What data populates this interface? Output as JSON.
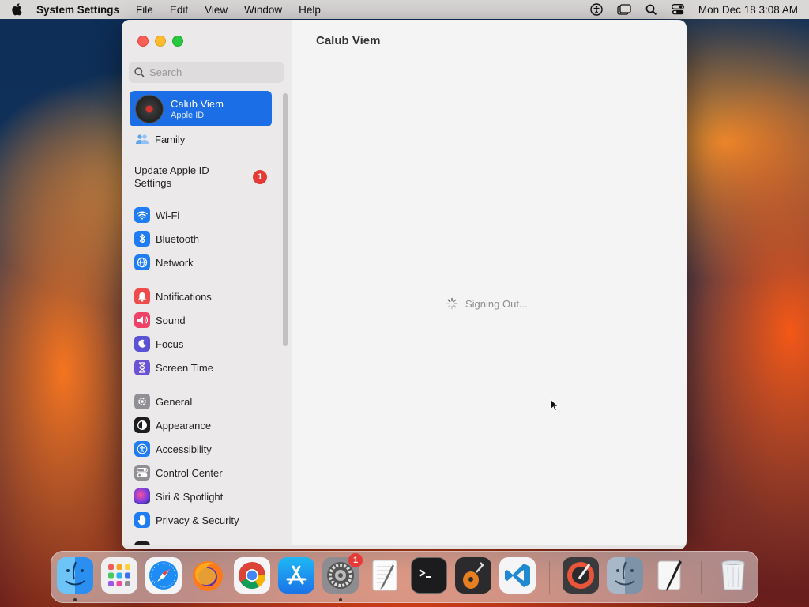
{
  "menubar": {
    "app_name": "System Settings",
    "items": [
      "File",
      "Edit",
      "View",
      "Window",
      "Help"
    ],
    "clock": "Mon Dec 18  3:08 AM"
  },
  "window": {
    "title": "Calub Viem",
    "status": "Signing Out..."
  },
  "sidebar": {
    "search_placeholder": "Search",
    "profile": {
      "name": "Calub Viem",
      "subtitle": "Apple ID"
    },
    "family": "Family",
    "update": {
      "label": "Update Apple ID Settings",
      "badge": "1"
    },
    "groups": [
      [
        {
          "label": "Wi-Fi",
          "icon": "wifi-icon",
          "color": "#1f7cf3"
        },
        {
          "label": "Bluetooth",
          "icon": "bluetooth-icon",
          "color": "#1f7cf3"
        },
        {
          "label": "Network",
          "icon": "network-globe-icon",
          "color": "#1f7cf3"
        }
      ],
      [
        {
          "label": "Notifications",
          "icon": "bell-icon",
          "color": "#ef4b4b"
        },
        {
          "label": "Sound",
          "icon": "speaker-icon",
          "color": "#ef4266"
        },
        {
          "label": "Focus",
          "icon": "moon-icon",
          "color": "#5a53d6"
        },
        {
          "label": "Screen Time",
          "icon": "hourglass-icon",
          "color": "#6b52d6"
        }
      ],
      [
        {
          "label": "General",
          "icon": "gear-icon",
          "color": "#8f8f94"
        },
        {
          "label": "Appearance",
          "icon": "appearance-icon",
          "color": "#1d1d1f"
        },
        {
          "label": "Accessibility",
          "icon": "accessibility-icon",
          "color": "#1f7cf3"
        },
        {
          "label": "Control Center",
          "icon": "control-center-icon",
          "color": "#8f8f94"
        },
        {
          "label": "Siri & Spotlight",
          "icon": "siri-icon",
          "color": "#b23cc8"
        },
        {
          "label": "Privacy & Security",
          "icon": "hand-icon",
          "color": "#1f7cf3"
        }
      ]
    ]
  },
  "dock": {
    "settings_badge": "1",
    "apps": [
      "Finder",
      "Launchpad",
      "Safari",
      "Firefox",
      "Chrome",
      "App Store",
      "System Settings",
      "TextEdit",
      "Terminal",
      "GarageBand",
      "Visual Studio Code",
      "Digital Color Meter",
      "Finder",
      "Script Editor",
      "Trash"
    ]
  }
}
